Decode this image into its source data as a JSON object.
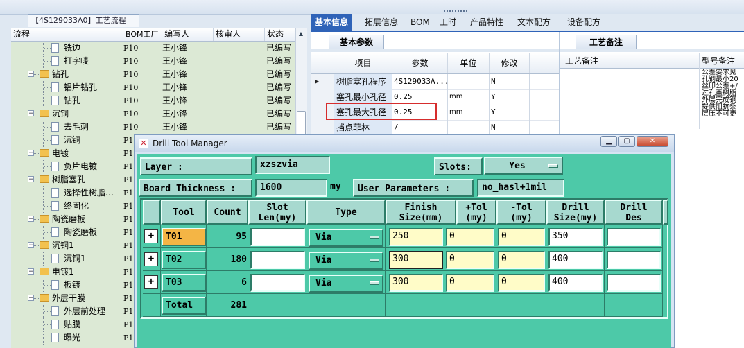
{
  "window": {
    "process_tab": "【4S129033A0】工艺流程"
  },
  "tree": {
    "headers": {
      "process": "流程",
      "bom": "BOM工厂",
      "author": "编写人",
      "reviewer": "核审人",
      "status": "状态"
    },
    "rows": [
      {
        "name": "铣边",
        "type": "item",
        "bom": "P10",
        "author": "王小锋",
        "status": "已编写"
      },
      {
        "name": "打字唛",
        "type": "item",
        "bom": "P10",
        "author": "王小锋",
        "status": "已编写"
      },
      {
        "name": "钻孔",
        "type": "group",
        "bom": "P10",
        "author": "王小锋",
        "status": "已编写"
      },
      {
        "name": "铝片钻孔",
        "type": "item",
        "bom": "P10",
        "author": "王小锋",
        "status": "已编写"
      },
      {
        "name": "钻孔",
        "type": "item",
        "bom": "P10",
        "author": "王小锋",
        "status": "已编写"
      },
      {
        "name": "沉铜",
        "type": "group",
        "bom": "P10",
        "author": "王小锋",
        "status": "已编写"
      },
      {
        "name": "去毛刺",
        "type": "item",
        "bom": "P10",
        "author": "王小锋",
        "status": "已编写"
      },
      {
        "name": "沉铜",
        "type": "item",
        "bom": "P1",
        "author": "",
        "status": ""
      },
      {
        "name": "电镀",
        "type": "group",
        "bom": "P1",
        "author": "",
        "status": ""
      },
      {
        "name": "负片电镀",
        "type": "item",
        "bom": "P1",
        "author": "",
        "status": ""
      },
      {
        "name": "树脂塞孔",
        "type": "group",
        "bom": "P1",
        "author": "",
        "status": ""
      },
      {
        "name": "选择性树脂…",
        "type": "item",
        "bom": "P1",
        "author": "",
        "status": ""
      },
      {
        "name": "终固化",
        "type": "item",
        "bom": "P1",
        "author": "",
        "status": ""
      },
      {
        "name": "陶瓷磨板",
        "type": "group",
        "bom": "P1",
        "author": "",
        "status": ""
      },
      {
        "name": "陶瓷磨板",
        "type": "item",
        "bom": "P1",
        "author": "",
        "status": ""
      },
      {
        "name": "沉铜1",
        "type": "group",
        "bom": "P1",
        "author": "",
        "status": ""
      },
      {
        "name": "沉铜1",
        "type": "item",
        "bom": "P1",
        "author": "",
        "status": ""
      },
      {
        "name": "电镀1",
        "type": "group",
        "bom": "P1",
        "author": "",
        "status": ""
      },
      {
        "name": "板镀",
        "type": "item",
        "bom": "P1",
        "author": "",
        "status": ""
      },
      {
        "name": "外层干膜",
        "type": "group",
        "bom": "P1",
        "author": "",
        "status": ""
      },
      {
        "name": "外层前处理",
        "type": "item",
        "bom": "P1",
        "author": "",
        "status": ""
      },
      {
        "name": "贴膜",
        "type": "item",
        "bom": "P1",
        "author": "",
        "status": ""
      },
      {
        "name": "曝光",
        "type": "item",
        "bom": "P1",
        "author": "",
        "status": ""
      }
    ]
  },
  "tabs": [
    "基本信息",
    "拓展信息",
    "BOM",
    "工时",
    "产品特性",
    "文本配方",
    "设备配方"
  ],
  "params": {
    "tab": "基本参数",
    "headers": [
      "项目",
      "参数",
      "单位",
      "修改"
    ],
    "rows": [
      {
        "item": "树脂塞孔程序",
        "value": "4S129033A...",
        "unit": "",
        "edit": "N"
      },
      {
        "item": "塞孔最小孔径",
        "value": "0.25",
        "unit": "mm",
        "edit": "Y"
      },
      {
        "item": "塞孔最大孔径",
        "value": "0.25",
        "unit": "mm",
        "edit": "Y"
      },
      {
        "item": "挡点菲林",
        "value": "/",
        "unit": "",
        "edit": "N"
      }
    ]
  },
  "notes": {
    "tab": "工艺备注",
    "col1": "工艺备注",
    "col2": "型号备注",
    "text": "公差要求见\n孔钢最小20\n丝印公差+/\n过孔盖树脂\n外层完成铜\n提供阻抗条\n层压不可更"
  },
  "dialog": {
    "title": "Drill Tool Manager",
    "layer_label": "Layer        :",
    "layer_value": "xzszvia",
    "slots_label": "Slots:",
    "slots_value": "Yes",
    "thickness_label": "Board Thickness :",
    "thickness_value": "1600",
    "thickness_unit": "my",
    "user_params_label": "User Parameters :",
    "user_params_value": "no_hasl+1mil",
    "columns": [
      "Tool",
      "Count",
      "Slot\nLen(my)",
      "Type",
      "Finish\nSize(mm)",
      "+Tol\n(my)",
      "-Tol\n(my)",
      "Drill\nSize(my)",
      "Drill\nDes"
    ],
    "tools": [
      {
        "tool": "T01",
        "count": "95",
        "slot": "",
        "type": "Via",
        "finish": "250",
        "ptol": "0",
        "ntol": "0",
        "drill": "350",
        "des": ""
      },
      {
        "tool": "T02",
        "count": "180",
        "slot": "",
        "type": "Via",
        "finish": "300",
        "ptol": "0",
        "ntol": "0",
        "drill": "400",
        "des": ""
      },
      {
        "tool": "T03",
        "count": "6",
        "slot": "",
        "type": "Via",
        "finish": "300",
        "ptol": "0",
        "ntol": "0",
        "drill": "400",
        "des": ""
      }
    ],
    "total_label": "Total",
    "total_count": "281"
  },
  "colors": {
    "dialog_bg": "#4dc9a8",
    "active_tab": "#2f63b8",
    "highlight": "#d62d2d",
    "tree_bg": "#dce9d5",
    "selected_tool": "#f4b545"
  }
}
